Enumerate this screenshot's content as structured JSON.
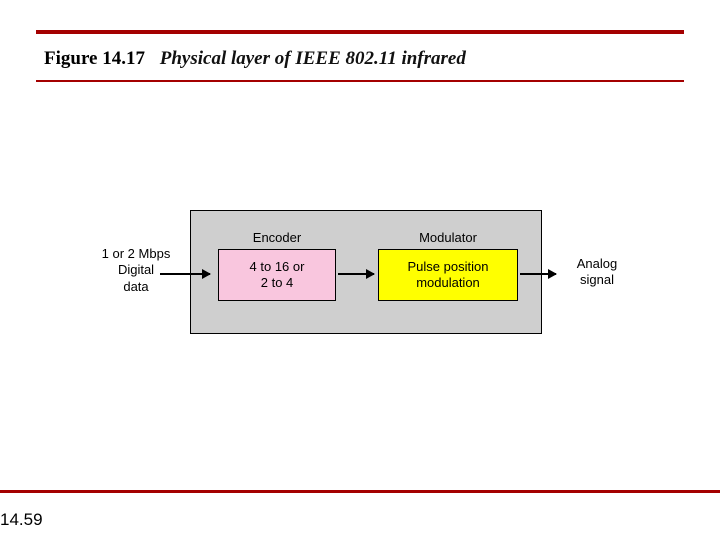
{
  "header": {
    "figure_number": "Figure 14.17",
    "caption": "Physical layer of IEEE 802.11 infrared"
  },
  "diagram": {
    "input": {
      "rate": "1 or 2 Mbps",
      "label1": "Digital",
      "label2": "data"
    },
    "encoder": {
      "title": "Encoder",
      "line1": "4 to 16 or",
      "line2": "2 to 4"
    },
    "modulator": {
      "title": "Modulator",
      "line1": "Pulse position",
      "line2": "modulation"
    },
    "output": {
      "label1": "Analog",
      "label2": "signal"
    }
  },
  "page_number": "14.59"
}
